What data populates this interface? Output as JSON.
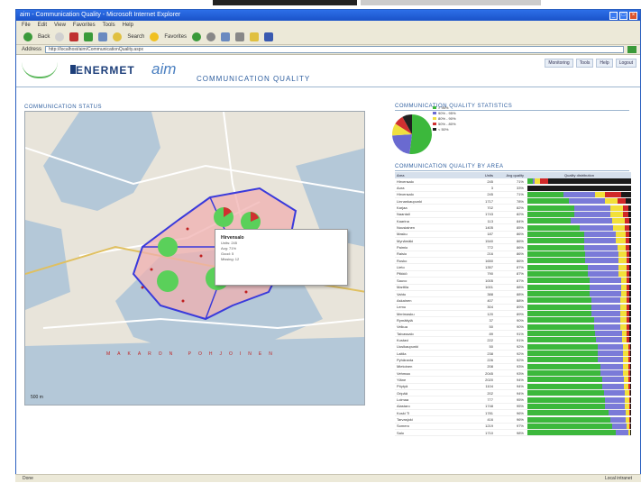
{
  "browser": {
    "title": "aim - Communication Quality - Microsoft Internet Explorer",
    "menu": [
      "File",
      "Edit",
      "View",
      "Favorites",
      "Tools",
      "Help"
    ],
    "toolbar": [
      "Back",
      "Search",
      "Favorites"
    ],
    "address_label": "Address",
    "address_value": "http://localhost/aim/CommunicationQuality.aspx",
    "status_text": "Done",
    "zone_text": "Local intranet"
  },
  "header": {
    "brand": "ENERMET",
    "product": "aim",
    "title": "COMMUNICATION QUALITY",
    "nav": [
      "Monitoring",
      "Tools",
      "Help",
      "Logout"
    ]
  },
  "sections": {
    "status": "COMMUNICATION STATUS",
    "stats": "COMMUNICATION QUALITY STATISTICS",
    "by_area": "COMMUNICATION QUALITY BY AREA"
  },
  "popup": {
    "title": "Hirvensalo",
    "lines": [
      "Units: 245",
      "Avg: 71%",
      "Good: 5",
      "Missing: 12"
    ]
  },
  "map": {
    "sea_label": "MAKARON POHJOINEN",
    "scale": "500 m"
  },
  "pie": {
    "slices": [
      {
        "label": "> 95%",
        "value": 52,
        "color": "#3cb83c"
      },
      {
        "label": "90% - 95%",
        "value": 22,
        "color": "#6a6ad0"
      },
      {
        "label": "80% - 90%",
        "value": 10,
        "color": "#f0e040"
      },
      {
        "label": "50% - 80%",
        "value": 8,
        "color": "#d03030"
      },
      {
        "label": "< 50%",
        "value": 8,
        "color": "#202020"
      }
    ]
  },
  "table": {
    "headers": [
      "Area",
      "Units",
      "Avg quality",
      "Quality distribution"
    ],
    "rows": [
      {
        "area": "Hirvensalo",
        "units": "245",
        "avg": "71%",
        "dist": [
          0.05,
          0.02,
          0.05,
          0.08,
          0.8
        ]
      },
      {
        "area": "Aura",
        "units": "3",
        "avg": "33%",
        "dist": [
          0,
          0,
          0,
          0,
          1
        ]
      },
      {
        "area": "Hirvensalo",
        "units": "245",
        "avg": "71%",
        "dist": [
          0.35,
          0.3,
          0.1,
          0.15,
          0.1
        ]
      },
      {
        "area": "Linnankaupunki",
        "units": "1717",
        "avg": "78%",
        "dist": [
          0.4,
          0.35,
          0.12,
          0.08,
          0.05
        ]
      },
      {
        "area": "Karjaa",
        "units": "702",
        "avg": "82%",
        "dist": [
          0.45,
          0.35,
          0.12,
          0.05,
          0.03
        ]
      },
      {
        "area": "Naantali",
        "units": "1743",
        "avg": "82%",
        "dist": [
          0.45,
          0.35,
          0.12,
          0.05,
          0.03
        ]
      },
      {
        "area": "Kaarina",
        "units": "113",
        "avg": "84%",
        "dist": [
          0.42,
          0.4,
          0.12,
          0.04,
          0.02
        ]
      },
      {
        "area": "Nousiainen",
        "units": "1405",
        "avg": "85%",
        "dist": [
          0.5,
          0.33,
          0.11,
          0.04,
          0.02
        ]
      },
      {
        "area": "Masku",
        "units": "187",
        "avg": "86%",
        "dist": [
          0.55,
          0.3,
          0.1,
          0.03,
          0.02
        ]
      },
      {
        "area": "Mynämäki",
        "units": "1540",
        "avg": "86%",
        "dist": [
          0.55,
          0.3,
          0.1,
          0.03,
          0.02
        ]
      },
      {
        "area": "Paimio",
        "units": "772",
        "avg": "86%",
        "dist": [
          0.55,
          0.32,
          0.08,
          0.03,
          0.02
        ]
      },
      {
        "area": "Raisio",
        "units": "216",
        "avg": "86%",
        "dist": [
          0.56,
          0.32,
          0.08,
          0.02,
          0.02
        ]
      },
      {
        "area": "Rusko",
        "units": "1650",
        "avg": "86%",
        "dist": [
          0.56,
          0.32,
          0.08,
          0.02,
          0.02
        ]
      },
      {
        "area": "Lieto",
        "units": "1357",
        "avg": "87%",
        "dist": [
          0.58,
          0.3,
          0.08,
          0.02,
          0.02
        ]
      },
      {
        "area": "Piikkiö",
        "units": "790",
        "avg": "87%",
        "dist": [
          0.58,
          0.3,
          0.08,
          0.02,
          0.02
        ]
      },
      {
        "area": "Sauvo",
        "units": "1005",
        "avg": "87%",
        "dist": [
          0.6,
          0.3,
          0.06,
          0.02,
          0.02
        ]
      },
      {
        "area": "Marttila",
        "units": "1001",
        "avg": "88%",
        "dist": [
          0.6,
          0.3,
          0.06,
          0.02,
          0.02
        ]
      },
      {
        "area": "Vahto",
        "units": "388",
        "avg": "88%",
        "dist": [
          0.6,
          0.3,
          0.06,
          0.02,
          0.02
        ]
      },
      {
        "area": "Askainen",
        "units": "407",
        "avg": "88%",
        "dist": [
          0.62,
          0.28,
          0.06,
          0.02,
          0.02
        ]
      },
      {
        "area": "Lemu",
        "units": "304",
        "avg": "89%",
        "dist": [
          0.62,
          0.28,
          0.06,
          0.02,
          0.02
        ]
      },
      {
        "area": "Merimasku",
        "units": "120",
        "avg": "89%",
        "dist": [
          0.62,
          0.28,
          0.06,
          0.02,
          0.02
        ]
      },
      {
        "area": "Rymättylä",
        "units": "37",
        "avg": "90%",
        "dist": [
          0.64,
          0.26,
          0.06,
          0.02,
          0.02
        ]
      },
      {
        "area": "Velkua",
        "units": "50",
        "avg": "90%",
        "dist": [
          0.64,
          0.26,
          0.06,
          0.02,
          0.02
        ]
      },
      {
        "area": "Taivassalo",
        "units": "89",
        "avg": "91%",
        "dist": [
          0.65,
          0.26,
          0.05,
          0.02,
          0.02
        ]
      },
      {
        "area": "Kustavi",
        "units": "222",
        "avg": "91%",
        "dist": [
          0.66,
          0.25,
          0.05,
          0.02,
          0.02
        ]
      },
      {
        "area": "Uusikaupunki",
        "units": "50",
        "avg": "92%",
        "dist": [
          0.68,
          0.24,
          0.05,
          0.02,
          0.01
        ]
      },
      {
        "area": "Laitila",
        "units": "238",
        "avg": "92%",
        "dist": [
          0.68,
          0.24,
          0.05,
          0.02,
          0.01
        ]
      },
      {
        "area": "Pyhäranta",
        "units": "226",
        "avg": "92%",
        "dist": [
          0.68,
          0.24,
          0.05,
          0.02,
          0.01
        ]
      },
      {
        "area": "Mietoinen",
        "units": "208",
        "avg": "93%",
        "dist": [
          0.7,
          0.22,
          0.05,
          0.02,
          0.01
        ]
      },
      {
        "area": "Vehmaa",
        "units": "2045",
        "avg": "93%",
        "dist": [
          0.7,
          0.22,
          0.05,
          0.02,
          0.01
        ]
      },
      {
        "area": "Yläne",
        "units": "2020",
        "avg": "94%",
        "dist": [
          0.72,
          0.21,
          0.04,
          0.02,
          0.01
        ]
      },
      {
        "area": "Pöytyä",
        "units": "1104",
        "avg": "94%",
        "dist": [
          0.72,
          0.21,
          0.04,
          0.02,
          0.01
        ]
      },
      {
        "area": "Oripää",
        "units": "202",
        "avg": "94%",
        "dist": [
          0.74,
          0.2,
          0.04,
          0.01,
          0.01
        ]
      },
      {
        "area": "Loimaa",
        "units": "777",
        "avg": "95%",
        "dist": [
          0.75,
          0.19,
          0.04,
          0.01,
          0.01
        ]
      },
      {
        "area": "Alastaro",
        "units": "1748",
        "avg": "95%",
        "dist": [
          0.75,
          0.19,
          0.04,
          0.01,
          0.01
        ]
      },
      {
        "area": "Koski Tl",
        "units": "1781",
        "avg": "96%",
        "dist": [
          0.78,
          0.17,
          0.03,
          0.01,
          0.01
        ]
      },
      {
        "area": "Tarvasjoki",
        "units": "416",
        "avg": "96%",
        "dist": [
          0.8,
          0.15,
          0.03,
          0.01,
          0.01
        ]
      },
      {
        "area": "Somero",
        "units": "1219",
        "avg": "97%",
        "dist": [
          0.82,
          0.14,
          0.02,
          0.01,
          0.01
        ]
      },
      {
        "area": "Salo",
        "units": "1710",
        "avg": "98%",
        "dist": [
          0.85,
          0.12,
          0.02,
          0.005,
          0.005
        ]
      }
    ]
  },
  "colors": {
    "green": "#3cb83c",
    "blue": "#7a7ad8",
    "yellow": "#f2e03a",
    "red": "#d02828",
    "black": "#1a1a1a"
  }
}
